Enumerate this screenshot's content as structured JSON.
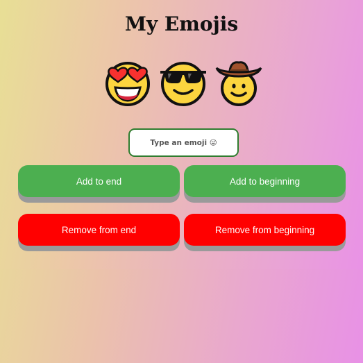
{
  "page": {
    "title": "My Emojis"
  },
  "emojis": [
    {
      "icon": "heart-eyes-face-icon"
    },
    {
      "icon": "sunglasses-face-icon"
    },
    {
      "icon": "cowboy-face-icon"
    }
  ],
  "input": {
    "placeholder": "Type an emoji 😜"
  },
  "buttons": {
    "add_end": "Add to end",
    "add_beginning": "Add to beginning",
    "remove_end": "Remove from end",
    "remove_beginning": "Remove from beginning"
  },
  "colors": {
    "add_button": "#4caf50",
    "remove_button": "#ff0000",
    "input_border": "#2f7d2f",
    "emoji_face": "#fcd53f"
  }
}
